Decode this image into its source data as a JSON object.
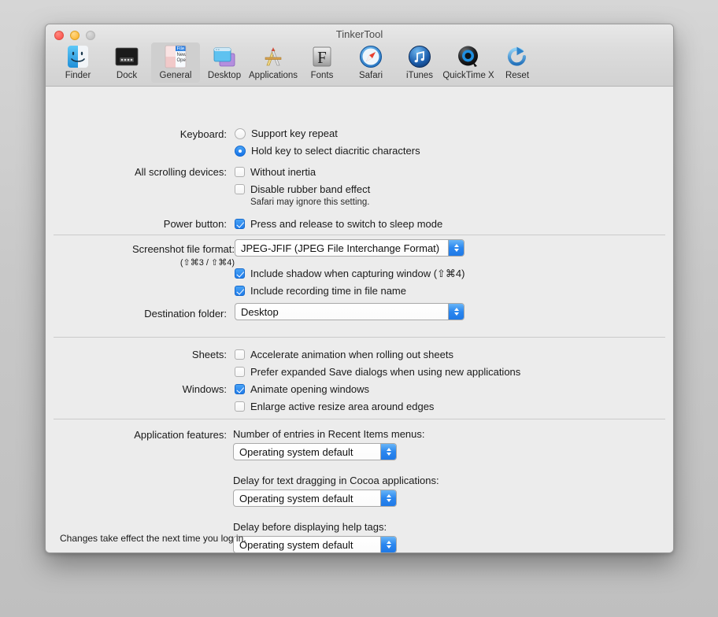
{
  "window": {
    "title": "TinkerTool",
    "traffic_lights": [
      {
        "name": "close",
        "color": "#fc5b55"
      },
      {
        "name": "minimize",
        "color": "#fdbc40"
      },
      {
        "name": "zoom",
        "color": "#c4c4c4"
      }
    ]
  },
  "toolbar": {
    "items": [
      {
        "label": "Finder",
        "icon": "finder-icon",
        "selected": false
      },
      {
        "label": "Dock",
        "icon": "dock-icon",
        "selected": false
      },
      {
        "label": "General",
        "icon": "general-icon",
        "selected": true
      },
      {
        "label": "Desktop",
        "icon": "desktop-icon",
        "selected": false
      },
      {
        "label": "Applications",
        "icon": "applications-icon",
        "selected": false
      },
      {
        "label": "Fonts",
        "icon": "fonts-icon",
        "selected": false
      },
      {
        "label": "Safari",
        "icon": "safari-icon",
        "selected": false
      },
      {
        "label": "iTunes",
        "icon": "itunes-icon",
        "selected": false
      },
      {
        "label": "QuickTime X",
        "icon": "quicktime-icon",
        "selected": false
      },
      {
        "label": "Reset",
        "icon": "reset-icon",
        "selected": false
      }
    ]
  },
  "sections": {
    "keyboard": {
      "label": "Keyboard:",
      "options": [
        {
          "text": "Support key repeat",
          "checked": false
        },
        {
          "text": "Hold key to select diacritic characters",
          "checked": true
        }
      ]
    },
    "scrolling": {
      "label": "All scrolling devices:",
      "options": [
        {
          "text": "Without inertia",
          "checked": false
        },
        {
          "text": "Disable rubber band effect",
          "checked": false
        }
      ],
      "note": "Safari may ignore this setting."
    },
    "power": {
      "label": "Power button:",
      "options": [
        {
          "text": "Press and release to switch to sleep mode",
          "checked": true
        }
      ]
    },
    "screenshot": {
      "label": "Screenshot file format:",
      "sublabel": "(⇧⌘3 / ⇧⌘4)",
      "format_value": "JPEG-JFIF (JPEG File Interchange Format)",
      "options": [
        {
          "text": "Include shadow when capturing window (⇧⌘4)",
          "checked": true
        },
        {
          "text": "Include recording time in file name",
          "checked": true
        }
      ],
      "destination_label": "Destination folder:",
      "destination_value": "Desktop"
    },
    "sheets": {
      "label": "Sheets:",
      "options": [
        {
          "text": "Accelerate animation when rolling out sheets",
          "checked": false
        },
        {
          "text": "Prefer expanded Save dialogs when using new applications",
          "checked": false
        }
      ]
    },
    "windows": {
      "label": "Windows:",
      "options": [
        {
          "text": "Animate opening windows",
          "checked": true
        },
        {
          "text": "Enlarge active resize area around edges",
          "checked": false
        }
      ]
    },
    "appfeatures": {
      "label": "Application features:",
      "groups": [
        {
          "caption": "Number of entries in Recent Items menus:",
          "value": "Operating system default"
        },
        {
          "caption": "Delay for text dragging in Cocoa applications:",
          "value": "Operating system default"
        },
        {
          "caption": "Delay before displaying help tags:",
          "value": "Operating system default"
        }
      ]
    }
  },
  "footer": {
    "text": "Changes take effect the next time you log in."
  },
  "colors": {
    "accent": "#2b87ef",
    "window_bg": "#ececec",
    "chrome_bg": "#dcdcdc",
    "separator": "#cbcbcb"
  }
}
